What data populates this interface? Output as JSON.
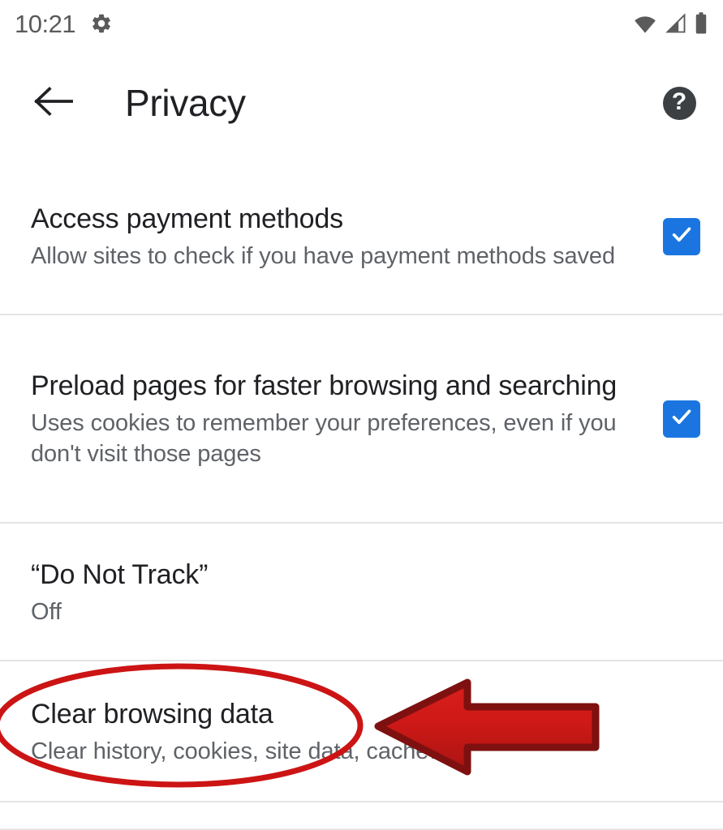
{
  "status_bar": {
    "time": "10:21",
    "icons": [
      "gear-icon",
      "wifi-icon",
      "cell-signal-icon",
      "battery-icon"
    ]
  },
  "app_bar": {
    "back_label": "back-arrow-icon",
    "title": "Privacy",
    "help_label": "?"
  },
  "settings": [
    {
      "title": "Access payment methods",
      "subtitle": "Allow sites to check if you have payment methods saved",
      "control": "checkbox",
      "checked": true
    },
    {
      "title": "Preload pages for faster browsing and searching",
      "subtitle": "Uses cookies to remember your preferences, even if you don't visit those pages",
      "control": "checkbox",
      "checked": true
    },
    {
      "title": "“Do Not Track”",
      "subtitle": "Off",
      "control": "none",
      "checked": false
    },
    {
      "title": "Clear browsing data",
      "subtitle": "Clear history, cookies, site data, cache…",
      "control": "none",
      "checked": false
    }
  ],
  "annotations": {
    "ellipse_color": "#CC1414",
    "arrow_fill": "#CC1A18",
    "arrow_stroke": "#7E1110",
    "target": "Clear browsing data"
  },
  "colors": {
    "accent_checkbox": "#1b75e0",
    "title_text": "#202124",
    "subtitle_text": "#5f6368",
    "divider": "#e4e4e4",
    "status_icon": "#5a5a5a",
    "help_circle": "#3c4043"
  }
}
